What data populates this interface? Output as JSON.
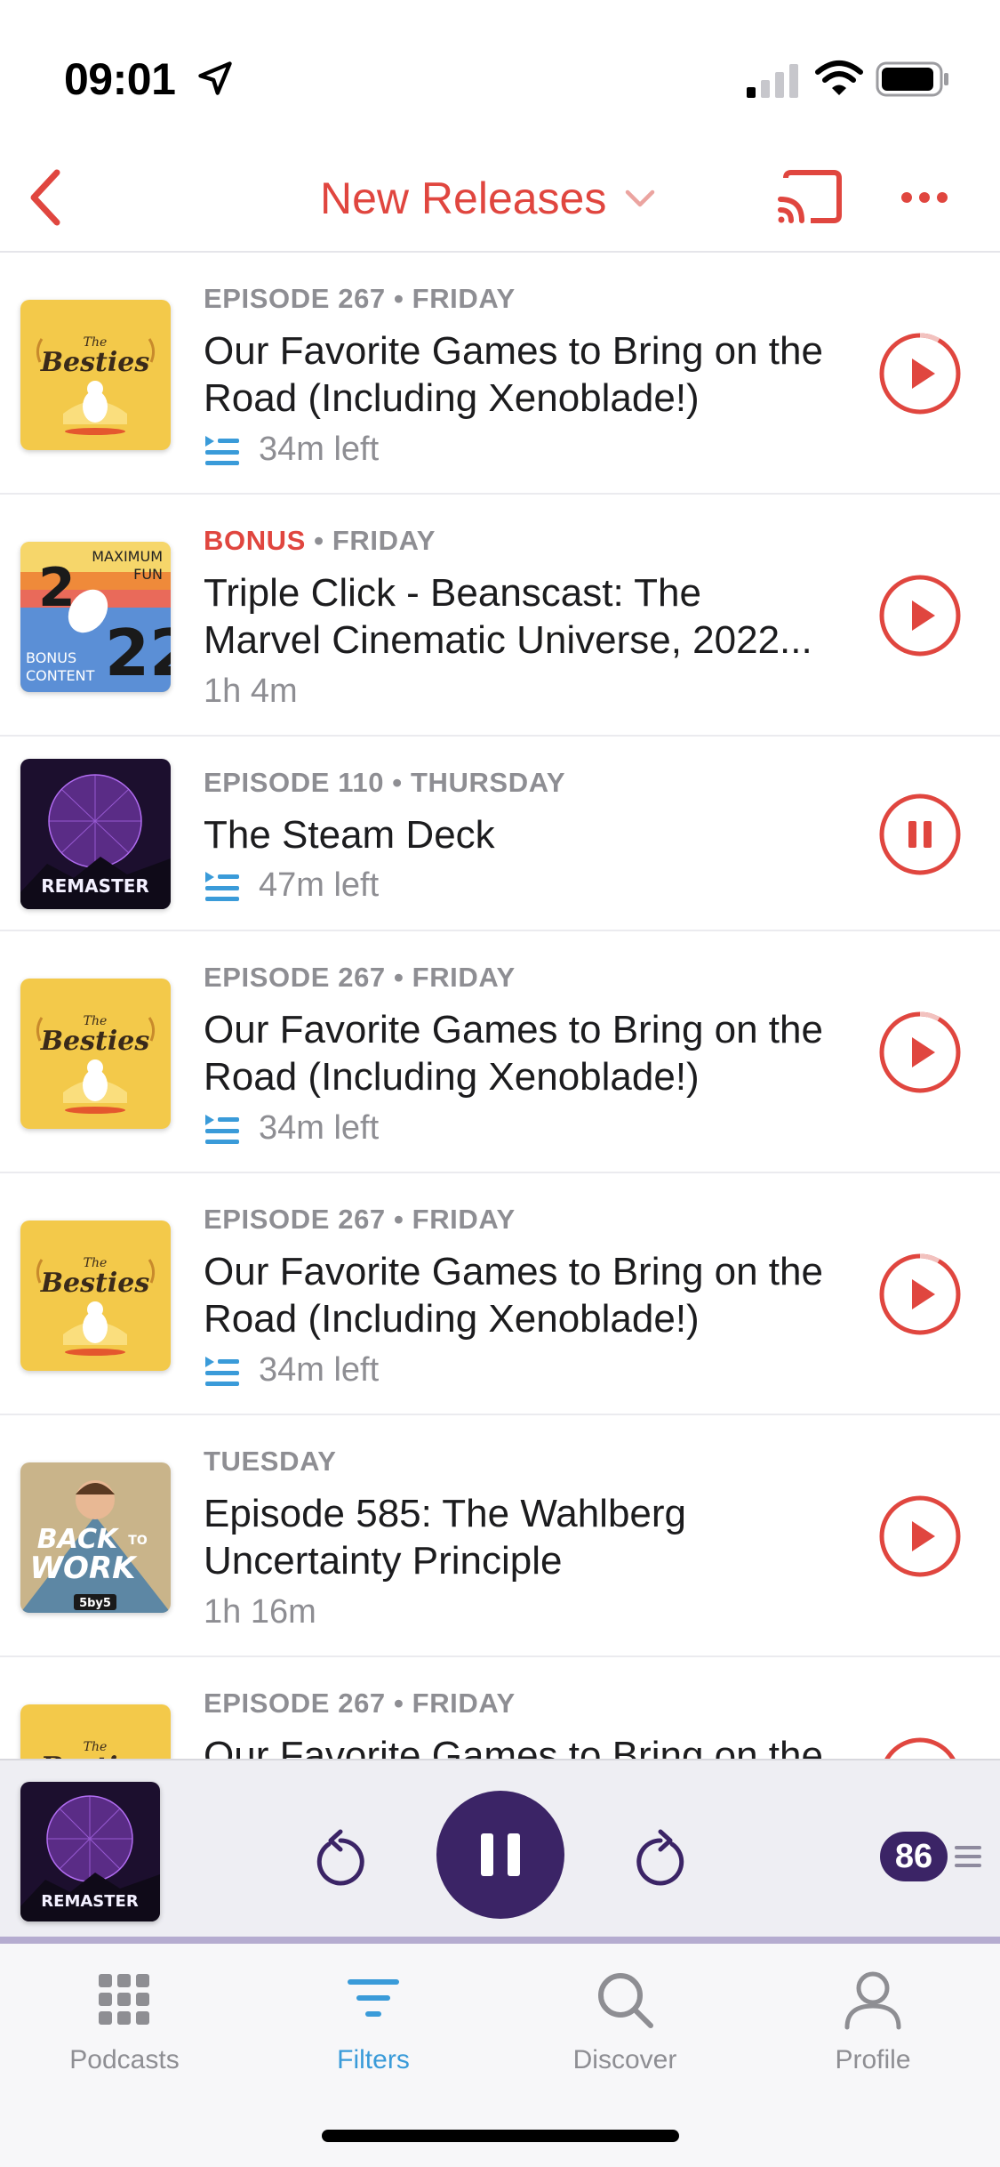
{
  "status_bar": {
    "time": "09:01"
  },
  "nav": {
    "title": "New Releases"
  },
  "episodes": [
    {
      "meta_prefix": "EPISODE 267",
      "meta_day": "FRIDAY",
      "title_line1": "Our Favorite Games to Bring on the",
      "title_line2": "Road (Including Xenoblade!)",
      "sub": "34m left",
      "queued": true,
      "state": "play",
      "art": "the-besties"
    },
    {
      "meta_prefix": "BONUS",
      "meta_day": "FRIDAY",
      "title_line1": "Triple Click - Beanscast: The",
      "title_line2": "Marvel Cinematic Universe, 2022...",
      "sub": "1h 4m",
      "queued": false,
      "state": "play",
      "art": "maximum-fun-2022"
    },
    {
      "meta_prefix": "EPISODE 110",
      "meta_day": "THURSDAY",
      "title_line1": "The Steam Deck",
      "title_line2": "",
      "sub": "47m left",
      "queued": true,
      "state": "pause",
      "art": "remaster"
    },
    {
      "meta_prefix": "EPISODE 267",
      "meta_day": "FRIDAY",
      "title_line1": "Our Favorite Games to Bring on the",
      "title_line2": "Road (Including Xenoblade!)",
      "sub": "34m left",
      "queued": true,
      "state": "play",
      "art": "the-besties"
    },
    {
      "meta_prefix": "EPISODE 267",
      "meta_day": "FRIDAY",
      "title_line1": "Our Favorite Games to Bring on the",
      "title_line2": "Road (Including Xenoblade!)",
      "sub": "34m left",
      "queued": true,
      "state": "play",
      "art": "the-besties"
    },
    {
      "meta_prefix": "",
      "meta_day": "TUESDAY",
      "title_line1": "Episode 585: The Wahlberg",
      "title_line2": "Uncertainty Principle",
      "sub": "1h 16m",
      "queued": false,
      "state": "play",
      "art": "back-to-work"
    },
    {
      "meta_prefix": "EPISODE 267",
      "meta_day": "FRIDAY",
      "title_line1": "Our Favorite Games to Bring on the",
      "title_line2": "",
      "sub": "",
      "queued": false,
      "state": "play",
      "art": "the-besties"
    }
  ],
  "art_text": {
    "besties_the": "The",
    "besties_name": "Besties",
    "maxfun_top": "MAXIMUM",
    "maxfun_fun": "FUN",
    "maxfun_bonus": "BONUS",
    "maxfun_content": "CONTENT",
    "remaster": "REMASTER",
    "btw_back": "BACK",
    "btw_to": "TO",
    "btw_work": "WORK",
    "btw_5by5": "5by5"
  },
  "mini_player": {
    "up_next_count": "86",
    "art": "remaster"
  },
  "tabs": [
    {
      "label": "Podcasts",
      "icon": "grid-icon",
      "active": false
    },
    {
      "label": "Filters",
      "icon": "filter-icon",
      "active": true
    },
    {
      "label": "Discover",
      "icon": "search-icon",
      "active": false
    },
    {
      "label": "Profile",
      "icon": "person-icon",
      "active": false
    }
  ],
  "colors": {
    "accent": "#e0463f",
    "player": "#3b2466",
    "tab_active": "#3a9bd9",
    "queue_icon": "#3a9bd9"
  }
}
